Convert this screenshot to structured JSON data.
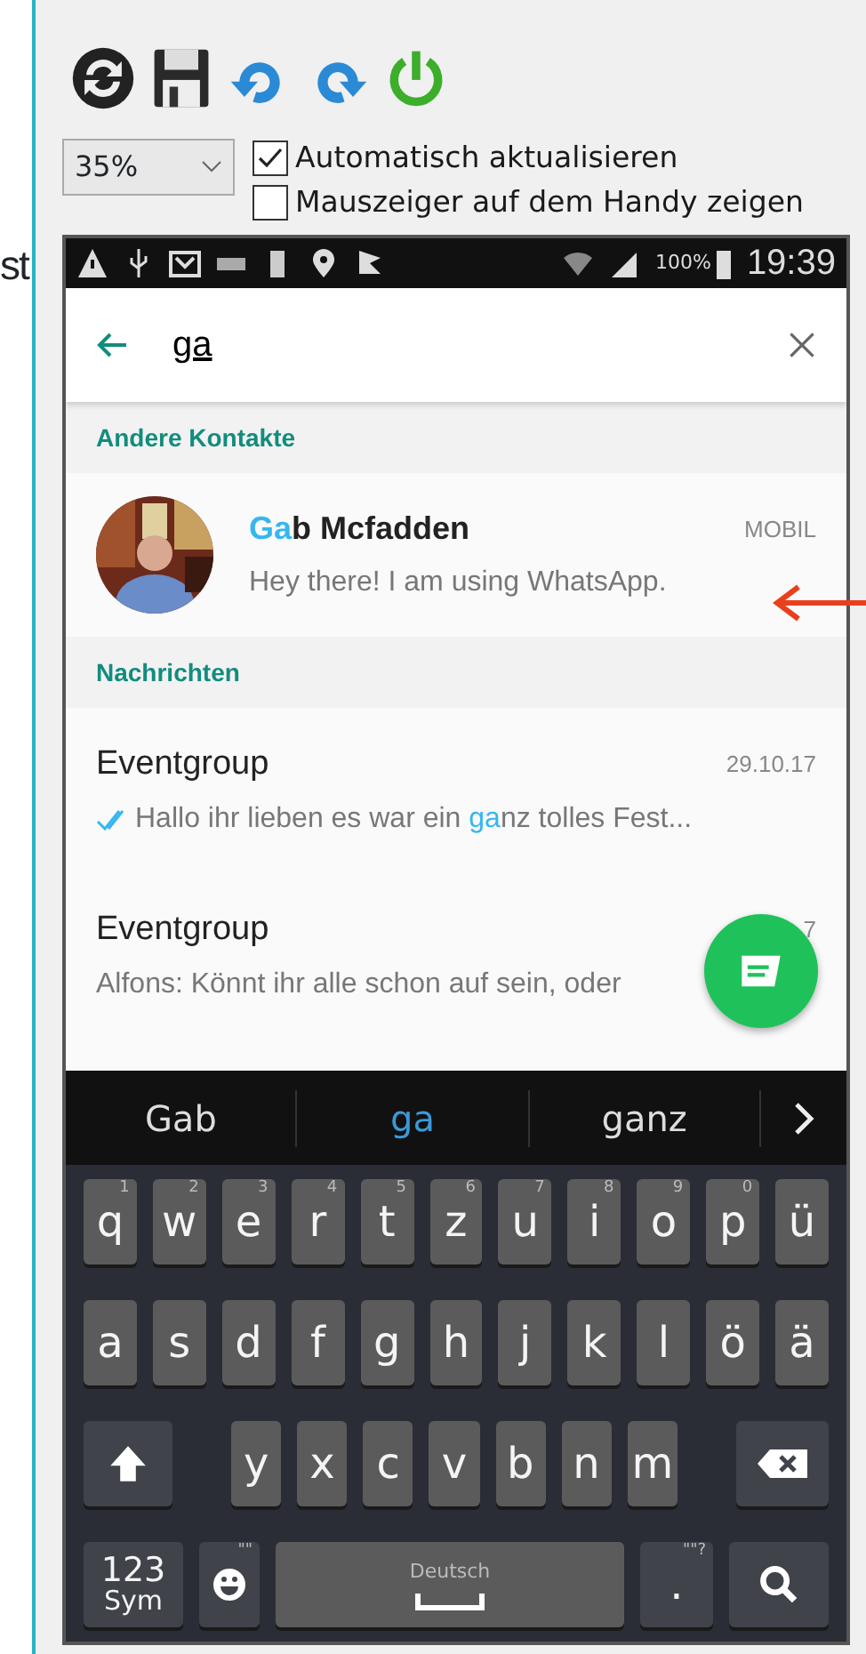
{
  "side_text": "st",
  "toolbar": {
    "buttons": [
      {
        "kind": "refresh"
      },
      {
        "kind": "save"
      },
      {
        "kind": "undo"
      },
      {
        "kind": "redo"
      },
      {
        "kind": "power"
      }
    ]
  },
  "zoom": {
    "value": "35%"
  },
  "options": [
    {
      "label": "Automatisch aktualisieren",
      "checked": true
    },
    {
      "label": "Mauszeiger auf dem Handy zeigen",
      "checked": false
    }
  ],
  "phone": {
    "status_bar": {
      "battery": "100%",
      "time": "19:39"
    },
    "search": {
      "value": "ga"
    },
    "sections": [
      {
        "title": "Andere Kontakte",
        "items": [
          {
            "kind": "contact",
            "name": [
              {
                "text": "Ga",
                "match": true
              },
              {
                "text": "b Mcfadden",
                "match": false
              }
            ],
            "tag": "MOBIL",
            "message": [
              {
                "text": "Hey there! I am using WhatsApp.",
                "match": false
              }
            ],
            "read_ticks": false
          }
        ]
      },
      {
        "title": "Nachrichten",
        "items": [
          {
            "kind": "chat",
            "name": [
              {
                "text": "Eventgroup",
                "match": false
              }
            ],
            "tag": "29.10.17",
            "message": [
              {
                "text": "Hallo  ihr  lieben  es war ein  ",
                "match": false
              },
              {
                "text": "ga",
                "match": true
              },
              {
                "text": "nz  tolles Fest...",
                "match": false
              }
            ],
            "read_ticks": true
          },
          {
            "kind": "chat",
            "name": [
              {
                "text": "Eventgroup",
                "match": false
              }
            ],
            "tag": "7",
            "message": [
              {
                "text": "Alfons: Könnt ihr alle schon auf sein, oder",
                "match": false
              }
            ],
            "read_ticks": false
          }
        ]
      }
    ],
    "suggestions": [
      {
        "text": "Gab",
        "selected": false
      },
      {
        "text": "ga",
        "selected": true
      },
      {
        "text": "ganz",
        "selected": false
      }
    ],
    "keyboard": [
      [
        {
          "kind": "char",
          "label": "q",
          "hint": "1"
        },
        {
          "kind": "char",
          "label": "w",
          "hint": "2"
        },
        {
          "kind": "char",
          "label": "e",
          "hint": "3"
        },
        {
          "kind": "char",
          "label": "r",
          "hint": "4"
        },
        {
          "kind": "char",
          "label": "t",
          "hint": "5"
        },
        {
          "kind": "char",
          "label": "z",
          "hint": "6"
        },
        {
          "kind": "char",
          "label": "u",
          "hint": "7"
        },
        {
          "kind": "char",
          "label": "i",
          "hint": "8"
        },
        {
          "kind": "char",
          "label": "o",
          "hint": "9"
        },
        {
          "kind": "char",
          "label": "p",
          "hint": "0"
        },
        {
          "kind": "char",
          "label": "ü"
        }
      ],
      [
        {
          "kind": "char",
          "label": "a"
        },
        {
          "kind": "char",
          "label": "s"
        },
        {
          "kind": "char",
          "label": "d"
        },
        {
          "kind": "char",
          "label": "f"
        },
        {
          "kind": "char",
          "label": "g"
        },
        {
          "kind": "char",
          "label": "h"
        },
        {
          "kind": "char",
          "label": "j"
        },
        {
          "kind": "char",
          "label": "k"
        },
        {
          "kind": "char",
          "label": "l"
        },
        {
          "kind": "char",
          "label": "ö"
        },
        {
          "kind": "char",
          "label": "ä"
        }
      ],
      [
        {
          "kind": "shift"
        },
        {
          "kind": "char",
          "label": "y"
        },
        {
          "kind": "char",
          "label": "x"
        },
        {
          "kind": "char",
          "label": "c"
        },
        {
          "kind": "char",
          "label": "v"
        },
        {
          "kind": "char",
          "label": "b"
        },
        {
          "kind": "char",
          "label": "n"
        },
        {
          "kind": "char",
          "label": "m"
        },
        {
          "kind": "backspace"
        }
      ],
      [
        {
          "kind": "sym",
          "label": "123",
          "sublabel": "Sym"
        },
        {
          "kind": "emoji",
          "hint": "\"\""
        },
        {
          "kind": "space",
          "label": "Deutsch"
        },
        {
          "kind": "char",
          "label": ".",
          "hint": "\"\"?"
        },
        {
          "kind": "search"
        }
      ]
    ]
  },
  "annotation": {
    "kind": "arrow"
  }
}
